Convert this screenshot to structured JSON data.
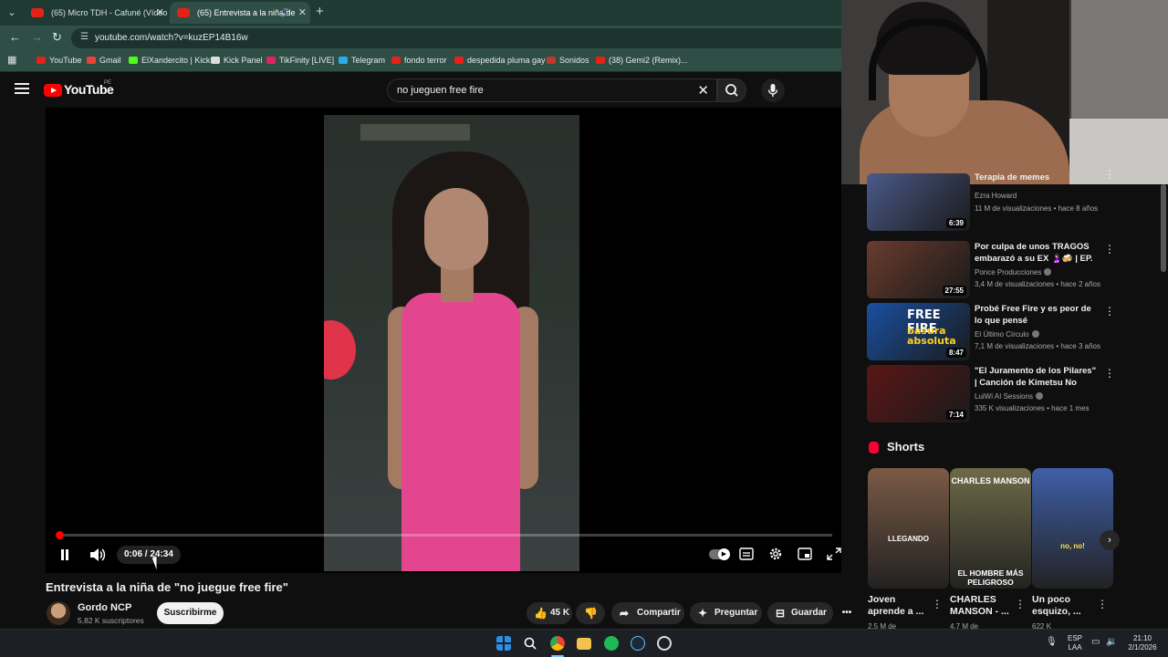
{
  "browser": {
    "tabs": [
      {
        "label": "(65) Micro TDH - Cafuné (Vídeo",
        "active": false
      },
      {
        "label": "(65) Entrevista a la niña de",
        "active": true
      }
    ],
    "url": "youtube.com/watch?v=kuzEP14B16w",
    "bookmarks": [
      {
        "label": "YouTube",
        "color": "#e62117"
      },
      {
        "label": "Gmail",
        "color": "#ea4335"
      },
      {
        "label": "ElXandercito | Kick",
        "color": "#53fc18"
      },
      {
        "label": "Kick Panel",
        "color": "#dddddd"
      },
      {
        "label": "TikFinity [LIVE]",
        "color": "#e0245e"
      },
      {
        "label": "Telegram",
        "color": "#2aabee"
      },
      {
        "label": "fondo terror",
        "color": "#e62117"
      },
      {
        "label": "despedida pluma gay",
        "color": "#e62117"
      },
      {
        "label": "Sonidos",
        "color": "#c0392b"
      },
      {
        "label": "(38) Gemi2 (Remix)...",
        "color": "#e62117"
      }
    ]
  },
  "youtube": {
    "logo_text": "YouTube",
    "country_code": "PE",
    "search_query": "no jueguen free fire"
  },
  "player": {
    "current_time": "0:06",
    "duration": "24:34",
    "time_display": "0:06 / 24:34",
    "progress_fraction": 0.004
  },
  "video": {
    "title": "Entrevista a la niña de \"no juegue free fire\"",
    "channel_name": "Gordo NCP",
    "channel_subs": "5,82 K suscriptores",
    "subscribe_label": "Suscribirme",
    "likes": "45 K",
    "share_label": "Compartir",
    "ask_label": "Preguntar",
    "save_label": "Guardar"
  },
  "related": [
    {
      "title": "Terapia de memes",
      "channel": "Ezra Howard",
      "verified": false,
      "meta": "11 M de visualizaciones • hace 8 años",
      "duration": "6:39",
      "thumb_color": "#4a5a8a"
    },
    {
      "title": "Por culpa de unos TRAGOS embarazó a su EX 🤰🏻🍻 | EP. ...",
      "channel": "Ponce Producciones",
      "verified": true,
      "meta": "3,4 M de visualizaciones • hace 2 años",
      "duration": "27:55",
      "thumb_color": "#6a3b2e"
    },
    {
      "title": "Probé Free Fire y es peor de lo que pensé",
      "channel": "El Último Círculo",
      "verified": true,
      "meta": "7,1 M de visualizaciones • hace 3 años",
      "duration": "8:47",
      "thumb_color": "#1a4fa0"
    },
    {
      "title": "\"El Juramento de los Pilares\" | Canción de Kimetsu No Yaiba ...",
      "channel": "LuiWi AI Sessions",
      "verified": true,
      "meta": "335 K visualizaciones • hace 1 mes",
      "duration": "7:14",
      "thumb_color": "#5a1616"
    }
  ],
  "thumb_text": {
    "free_fire_top": "FREE FIRE",
    "free_fire_bottom": "basura absoluta"
  },
  "shorts": {
    "heading": "Shorts",
    "items": [
      {
        "title": "Joven aprende a ...",
        "views": "2,5 M de",
        "caption": "LLEGANDO",
        "color": "#7b5a45"
      },
      {
        "title": "CHARLES MANSON - ...",
        "views": "4,7 M de",
        "caption_top": "CHARLES MANSON",
        "caption": "EL HOMBRE MÁS PELIGROSO",
        "color": "#6e6a48"
      },
      {
        "title": "Un poco esquizo, ...",
        "views": "622 K",
        "caption": "no, no!",
        "color": "#3f5fa8"
      }
    ]
  },
  "taskbar": {
    "lang_top": "ESP",
    "lang_bottom": "LAA",
    "time": "21:10",
    "date": "2/1/2026"
  }
}
